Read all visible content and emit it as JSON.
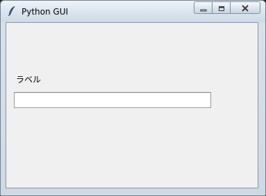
{
  "window": {
    "title": "Python GUI",
    "app_icon": "feather-icon"
  },
  "caption_buttons": {
    "minimize_icon": "minimize-icon",
    "maximize_icon": "maximize-icon",
    "close_icon": "close-icon"
  },
  "main": {
    "label": "ラベル",
    "entry_value": ""
  },
  "colors": {
    "client_bg": "#f0f0f0",
    "frame": "#d7e1ec"
  }
}
